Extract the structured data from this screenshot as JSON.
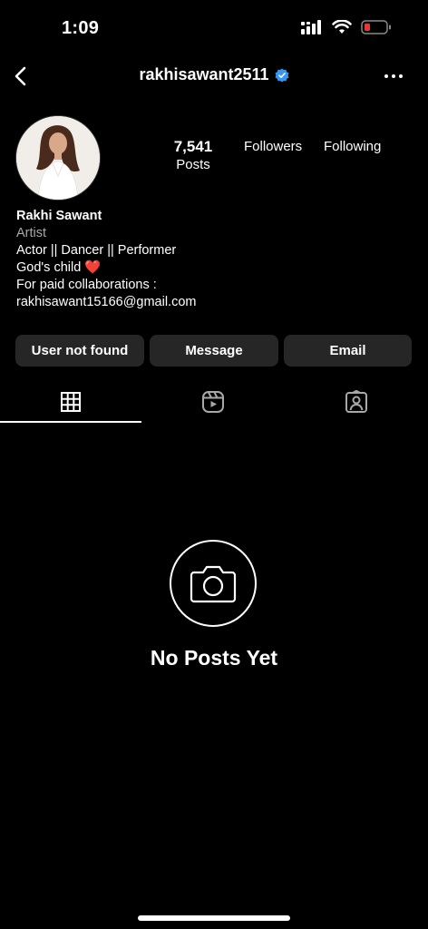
{
  "status_bar": {
    "time": "1:09",
    "icons": [
      "cellular-signal-icon",
      "wifi-icon",
      "battery-low-icon"
    ],
    "battery_color": "#e53935"
  },
  "header": {
    "username": "rakhisawant2511",
    "verified_color": "#3797f0",
    "icons": [
      "back-chevron-icon",
      "verified-badge-icon",
      "more-options-icon"
    ]
  },
  "profile": {
    "stats": {
      "posts_count": "7,541",
      "posts_label": "Posts",
      "followers_label": "Followers",
      "following_label": "Following"
    },
    "name": "Rakhi Sawant",
    "category": "Artist",
    "bio_line1": "Actor || Dancer || Performer",
    "bio_line2": "God's child",
    "bio_emoji": "❤️",
    "bio_line3": "For paid collaborations :",
    "bio_line4": "rakhisawant15166@gmail.com"
  },
  "actions": {
    "user_not_found": "User not found",
    "message": "Message",
    "email": "Email"
  },
  "tabs": {
    "items": [
      "grid-icon",
      "reels-icon",
      "tagged-icon"
    ],
    "active": 0
  },
  "empty_state": {
    "title": "No Posts Yet",
    "icon": "camera-icon"
  }
}
